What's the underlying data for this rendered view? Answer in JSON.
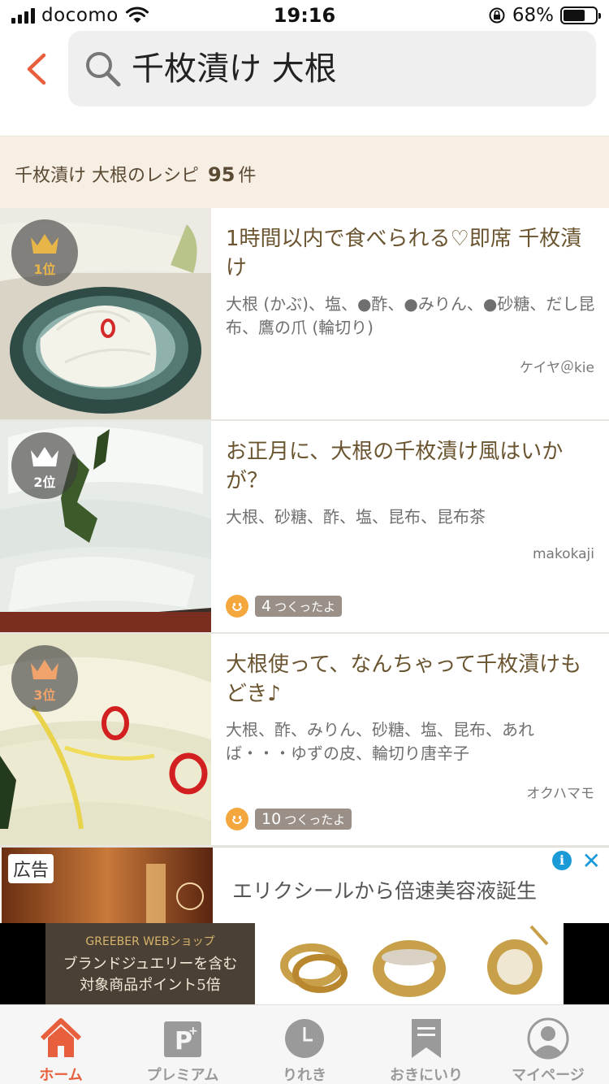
{
  "status_bar": {
    "carrier": "docomo",
    "time": "19:16",
    "battery": "68%",
    "battery_level": 0.68
  },
  "search": {
    "query": "千枚漬け 大根"
  },
  "results": {
    "prefix": "千枚漬け 大根のレシピ",
    "count": "95",
    "suffix": "件"
  },
  "recipes": [
    {
      "rank": "1位",
      "rank_color": "#e8b548",
      "title": "1時間以内で食べられる♡即席 千枚漬け",
      "ingredients": "大根 (かぶ)、塩、●酢、●みりん、●砂糖、だし昆布、鷹の爪 (輪切り)",
      "author": "ケイヤ＠kie",
      "tsukurepo_count": "",
      "tsukurepo_label": ""
    },
    {
      "rank": "2位",
      "rank_color": "#ffffff",
      "title": "お正月に、大根の千枚漬け風はいかが？",
      "ingredients": "大根、砂糖、酢、塩、昆布、昆布茶",
      "author": "makokaji",
      "tsukurepo_count": "4",
      "tsukurepo_label": "つくったよ"
    },
    {
      "rank": "3位",
      "rank_color": "#f0a36a",
      "title": "大根使って、なんちゃって千枚漬けもどき♪",
      "ingredients": "大根、酢、みりん、砂糖、塩、昆布、あれば・・・ゆずの皮、輪切り唐辛子",
      "author": "オクハマモ",
      "tsukurepo_count": "10",
      "tsukurepo_label": "つくったよ"
    }
  ],
  "ad": {
    "badge": "広告",
    "text": "エリクシールから倍速美容液誕生",
    "close": "✕"
  },
  "banner": {
    "shop": "GREEBER WEBショップ",
    "line1": "ブランドジュエリーを含む",
    "line2": "対象商品ポイント5倍"
  },
  "tabs": [
    {
      "label": "ホーム",
      "icon": "home-icon",
      "active": true
    },
    {
      "label": "プレミアム",
      "icon": "premium-icon",
      "active": false
    },
    {
      "label": "りれき",
      "icon": "history-icon",
      "active": false
    },
    {
      "label": "おきにいり",
      "icon": "bookmark-icon",
      "active": false
    },
    {
      "label": "マイページ",
      "icon": "user-icon",
      "active": false
    }
  ],
  "colors": {
    "accent": "#e85f3e",
    "count_bar_bg": "#f7efe3",
    "title_text": "#6b5530",
    "tsukurepo_face": "#f3a73c"
  }
}
